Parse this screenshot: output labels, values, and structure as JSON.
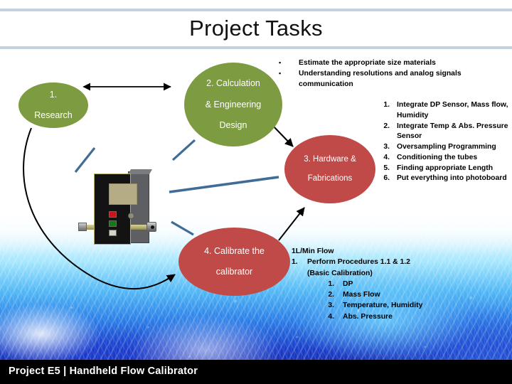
{
  "slide": {
    "title": "Project Tasks",
    "footer": "Project E5 | Handheld Flow Calibrator"
  },
  "nodes": [
    {
      "id": "node1",
      "label": "1.\nResearch",
      "line1": "1.",
      "line2": "Research",
      "color": "#7d9b40"
    },
    {
      "id": "node2",
      "line1": "2. Calculation",
      "line2": "& Engineering",
      "line3": "Design",
      "color": "#7d9b40"
    },
    {
      "id": "node3",
      "line1": "3. Hardware &",
      "line2": "Fabrications",
      "color": "#c04a48"
    },
    {
      "id": "node4",
      "line1": "4. Calibrate the",
      "line2": "calibrator",
      "color": "#c04a48"
    }
  ],
  "bullets": {
    "marker": "▪",
    "items": [
      "Estimate the appropriate size materials",
      "Understanding resolutions and analog signals communication"
    ]
  },
  "numbered_list": {
    "items": [
      {
        "num": "1.",
        "text": "Integrate DP Sensor, Mass flow, Humidity"
      },
      {
        "num": "2.",
        "text": "Integrate Temp & Abs. Pressure Sensor"
      },
      {
        "num": "3.",
        "text": "Oversampling Programming"
      },
      {
        "num": "4.",
        "text": "Conditioning the tubes"
      },
      {
        "num": "5.",
        "text": "Finding appropriate Length"
      },
      {
        "num": "6.",
        "text": "Put everything into photoboard"
      }
    ]
  },
  "flow_block": {
    "heading": "1L/Min Flow",
    "item_num": "1.",
    "item_text": "Perform Procedures 1.1 & 1.2",
    "item_cont": "(Basic Calibration)",
    "sub_items": [
      {
        "num": "1.",
        "text": "DP"
      },
      {
        "num": "2.",
        "text": "Mass Flow"
      },
      {
        "num": "3.",
        "text": "Temperature, Humidity"
      },
      {
        "num": "4.",
        "text": "Abs. Pressure"
      }
    ]
  },
  "device": {
    "name": "handheld-flow-calibrator",
    "screen_color": "#b5ab85",
    "body_color": "#131313",
    "buttons": [
      "red",
      "green",
      "grey"
    ]
  },
  "colors": {
    "green": "#7d9b40",
    "red": "#c04a48",
    "rule": "#c3d2de",
    "connector_blue": "#3f6d96",
    "connector_black": "#000000",
    "footer_bg": "#000000"
  }
}
